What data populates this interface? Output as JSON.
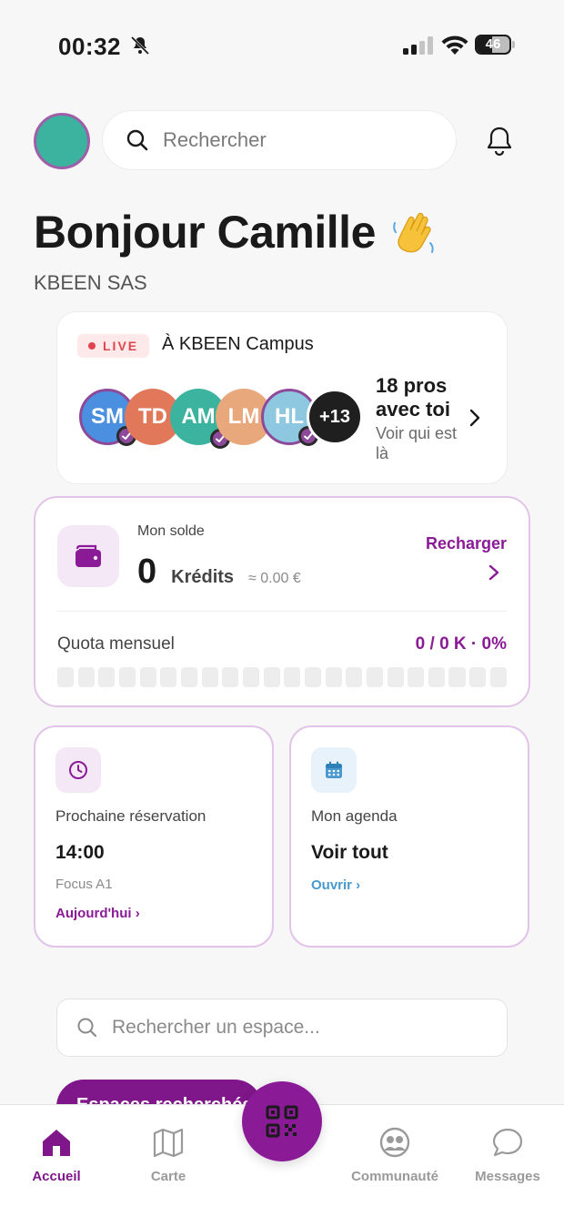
{
  "status_bar": {
    "time": "00:32",
    "battery": "46",
    "battery_level": 0.46
  },
  "header": {
    "search_placeholder": "Rechercher"
  },
  "greeting": {
    "title": "Bonjour Camille",
    "emoji": "waving-hand",
    "company": "KBEEN SAS"
  },
  "live": {
    "badge": "LIVE",
    "place": "À KBEEN Campus",
    "people": [
      {
        "initials": "SM",
        "color": "#4a8fe0",
        "checked": true
      },
      {
        "initials": "TD",
        "color": "#e2785a",
        "checked": false
      },
      {
        "initials": "AM",
        "color": "#3cb39f",
        "checked": true
      },
      {
        "initials": "LM",
        "color": "#e8a87c",
        "checked": false
      },
      {
        "initials": "HL",
        "color": "#8ec8e0",
        "checked": true
      },
      {
        "initials": "+13",
        "color": "#1f1f1f",
        "checked": false
      }
    ],
    "count_title": "18 pros avec toi",
    "count_sub": "Voir qui est là"
  },
  "balance": {
    "label": "Mon solde",
    "amount": "0",
    "unit": "Krédits",
    "eur": "≈ 0.00 €",
    "recharge": "Recharger",
    "quota_label": "Quota mensuel",
    "quota_value": "0 / 0 K · 0%",
    "quota_fraction": 0,
    "quota_segments": 22
  },
  "cards": {
    "reservation": {
      "label": "Prochaine réservation",
      "value": "14:00",
      "sub": "Focus A1",
      "link": "Aujourd'hui ›"
    },
    "agenda": {
      "label": "Mon agenda",
      "value": "Voir tout",
      "link": "Ouvrir ›"
    }
  },
  "space_search": {
    "placeholder": "Rechercher un espace..."
  },
  "spaces_pill": {
    "label": "Espaces recherchés"
  },
  "nav": {
    "home": "Accueil",
    "map": "Carte",
    "community": "Communauté",
    "messages": "Messages"
  },
  "colors": {
    "accent": "#8a1a96",
    "accent_dark": "#7f1689",
    "live_red": "#e0454f",
    "link_blue": "#4a9ad0"
  }
}
